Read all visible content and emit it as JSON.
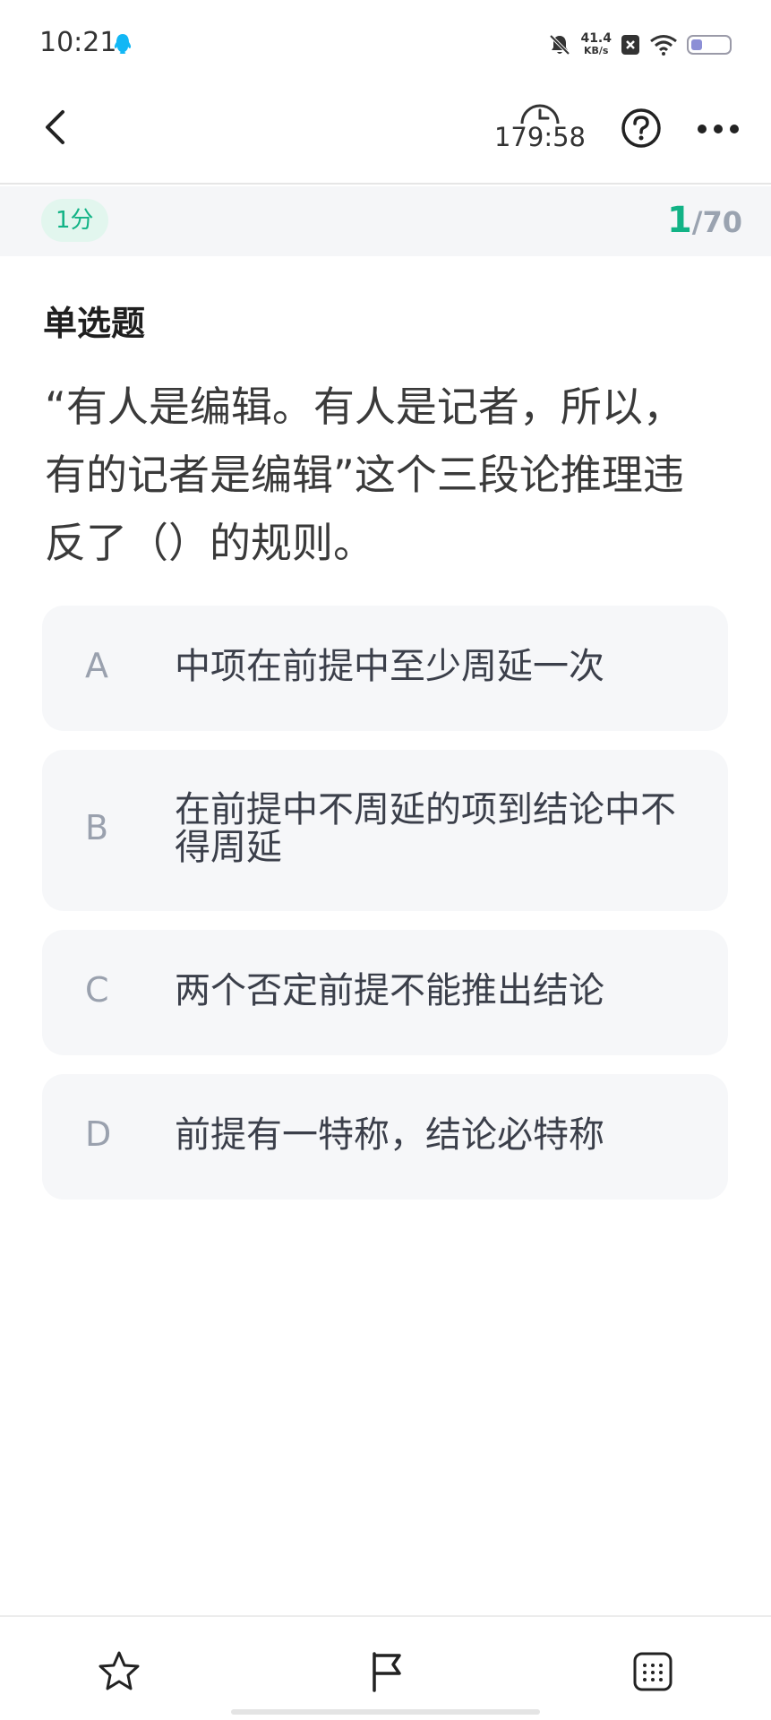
{
  "status_bar": {
    "time": "10:21",
    "net_speed_value": "41.4",
    "net_speed_unit": "KB/s",
    "battery_level": 0.3
  },
  "header": {
    "timer": "179:58"
  },
  "score_bar": {
    "score": "1分",
    "current": "1",
    "total": "/70"
  },
  "question": {
    "type": "单选题",
    "stem": "“有人是编辑。有人是记者，所以，有的记者是编辑”这个三段论推理违反了（）的规则。"
  },
  "options": [
    {
      "letter": "A",
      "text": "中项在前提中至少周延一次"
    },
    {
      "letter": "B",
      "text": "在前提中不周延的项到结论中不得周延"
    },
    {
      "letter": "C",
      "text": "两个否定前提不能推出结论"
    },
    {
      "letter": "D",
      "text": "前提有一特称，结论必特称"
    }
  ],
  "colors": {
    "accent": "#12b386",
    "option_bg": "#f6f7f9",
    "score_badge_bg": "#e2f6ee"
  },
  "icons": {
    "back": "chevron-left-icon",
    "timer": "clock-icon",
    "help": "question-circle-icon",
    "more": "more-dots-icon",
    "favorite": "star-icon",
    "mark": "flag-icon",
    "answer_sheet": "grid-icon"
  }
}
